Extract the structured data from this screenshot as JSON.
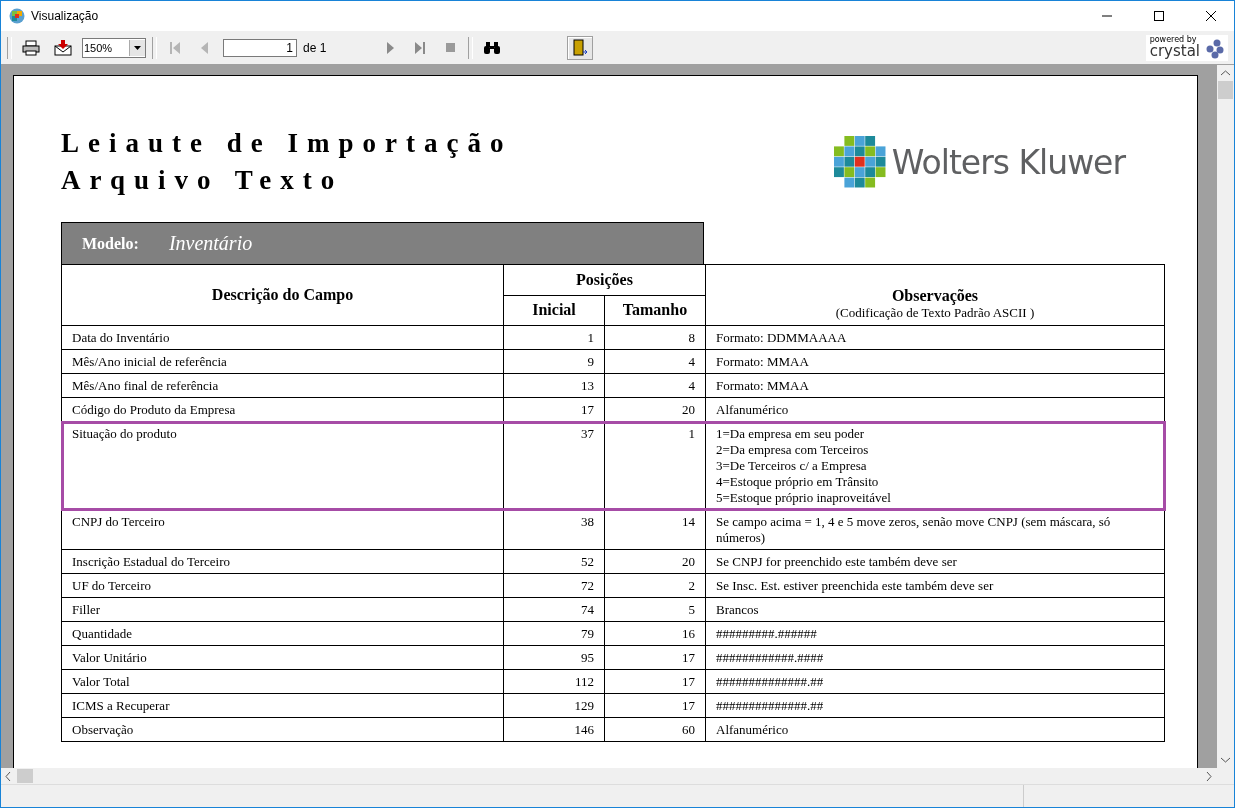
{
  "window": {
    "title": "Visualização"
  },
  "toolbar": {
    "zoom": "150%",
    "page": "1",
    "page_count": "de 1",
    "first_disabled": true,
    "prev_disabled": true,
    "next_disabled": false,
    "last_disabled": false,
    "exit_pressed": true
  },
  "branding": {
    "powered": "powered by",
    "name": "crystal"
  },
  "report": {
    "title_lines": [
      "Leiaute de Importação",
      "Arquivo Texto"
    ],
    "logo_text": "Wolters Kluwer",
    "model_label": "Modelo:",
    "model_value": "Inventário",
    "headers": {
      "description": "Descrição do Campo",
      "positions": "Posições",
      "start": "Inicial",
      "size": "Tamanho",
      "notes": "Observações",
      "notes_sub": "(Codificação de Texto Padrão ASCII )"
    },
    "rows": [
      {
        "field": "Data do Inventário",
        "start": "1",
        "size": "8",
        "notes": [
          "Formato: DDMMAAAA"
        ],
        "selected": false
      },
      {
        "field": "Mês/Ano inicial de referência",
        "start": "9",
        "size": "4",
        "notes": [
          "Formato: MMAA"
        ],
        "selected": false
      },
      {
        "field": "Mês/Ano final de referência",
        "start": "13",
        "size": "4",
        "notes": [
          "Formato: MMAA"
        ],
        "selected": false
      },
      {
        "field": "Código do Produto da Empresa",
        "start": "17",
        "size": "20",
        "notes": [
          "Alfanumérico"
        ],
        "selected": false
      },
      {
        "field": "Situação do produto",
        "start": "37",
        "size": "1",
        "notes": [
          "1=Da empresa em seu poder",
          "2=Da empresa com Terceiros",
          "3=De Terceiros c/ a Empresa",
          "4=Estoque próprio em Trânsito",
          "5=Estoque próprio inaproveitável"
        ],
        "selected": true
      },
      {
        "field": "CNPJ do Terceiro",
        "start": "38",
        "size": "14",
        "notes": [
          "Se campo acima = 1, 4 e 5 move zeros, senão move CNPJ (sem máscara, só números)"
        ],
        "selected": false
      },
      {
        "field": "Inscrição Estadual do Terceiro",
        "start": "52",
        "size": "20",
        "notes": [
          "Se CNPJ for preenchido este também deve ser"
        ],
        "selected": false
      },
      {
        "field": "UF do Terceiro",
        "start": "72",
        "size": "2",
        "notes": [
          "Se Insc. Est. estiver preenchida este também deve ser"
        ],
        "selected": false
      },
      {
        "field": "Filler",
        "start": "74",
        "size": "5",
        "notes": [
          "Brancos"
        ],
        "selected": false
      },
      {
        "field": "Quantidade",
        "start": "79",
        "size": "16",
        "notes": [
          "#########.######"
        ],
        "selected": false
      },
      {
        "field": "Valor Unitário",
        "start": "95",
        "size": "17",
        "notes": [
          "############.####"
        ],
        "selected": false
      },
      {
        "field": "Valor Total",
        "start": "112",
        "size": "17",
        "notes": [
          "##############.##"
        ],
        "selected": false
      },
      {
        "field": "ICMS a Recuperar",
        "start": "129",
        "size": "17",
        "notes": [
          "##############.##"
        ],
        "selected": false
      },
      {
        "field": "Observação",
        "start": "146",
        "size": "60",
        "notes": [
          "Alfanumérico"
        ],
        "selected": false
      }
    ]
  }
}
